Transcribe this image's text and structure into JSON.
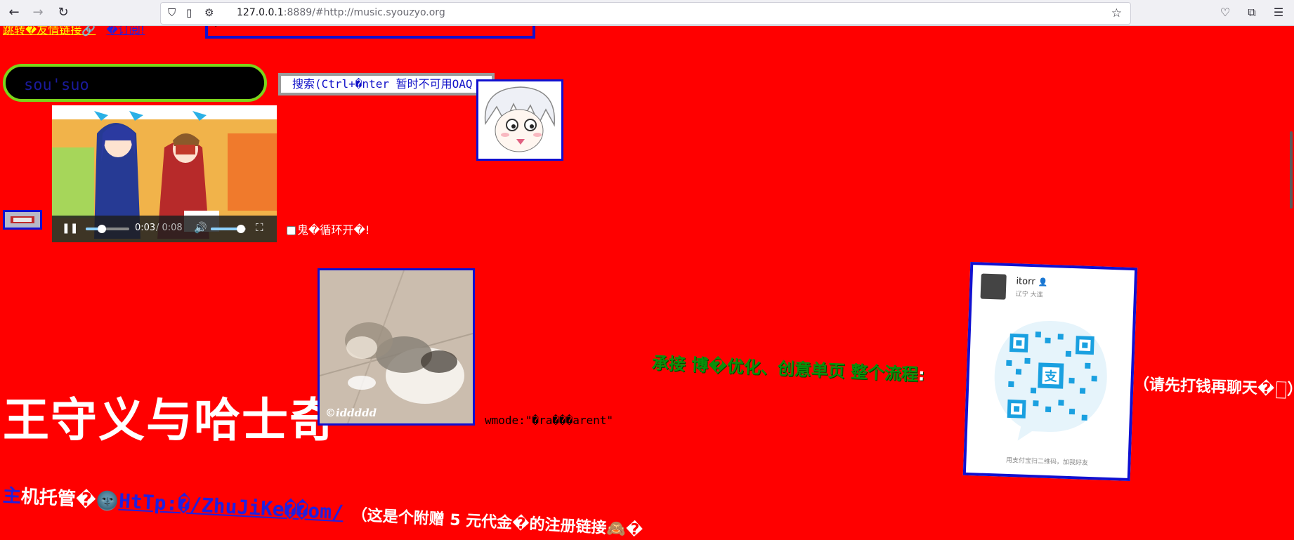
{
  "browser": {
    "url_host": "127.0.0.1",
    "url_rest": ":8889/#http://music.syouzyo.org",
    "icons": [
      "back-icon",
      "forward-icon",
      "reload-icon",
      "shield-icon",
      "page-icon",
      "permissions-icon",
      "bookmark-star-icon",
      "pocket-icon",
      "extensions-icon",
      "menu-icon"
    ]
  },
  "top": {
    "link1": "跳转�友情链接🔗",
    "link2": "�订阅!",
    "box_glyph": "�"
  },
  "search": {
    "input_value": "sou'suo",
    "button_label": "搜索(Ctrl+�nter 暂时不可用OAQ"
  },
  "video": {
    "time_current": "0:03",
    "time_total": "/ 0:08",
    "progress": 0.375,
    "volume": 0.85
  },
  "loop": {
    "label": "鬼�循环开�!"
  },
  "title": "王守义与哈士奇",
  "cat_photo": {
    "watermark": "©iddddd"
  },
  "wmode": "wmode:\"�ra���arent\"",
  "services": "承接  博�优化、创意单页  整个流程",
  "services_colon": ":",
  "qr": {
    "name": "itorr",
    "location": "辽宁 大连",
    "caption": "用支付宝扫二维码，加我好友"
  },
  "pay_note": "（请先打钱再聊天�",
  "pay_note_end": "）",
  "host": {
    "a": "主",
    "b": "机托管�🌚",
    "link": "HtTp:�/ZhuJiKe��om/",
    "note": "（这是个附赠  5  元代金�的注册链接🙈�"
  },
  "colors": {
    "page_bg": "#ff0000",
    "accent_border": "#1010d0",
    "green_text": "#0b8f0b"
  }
}
